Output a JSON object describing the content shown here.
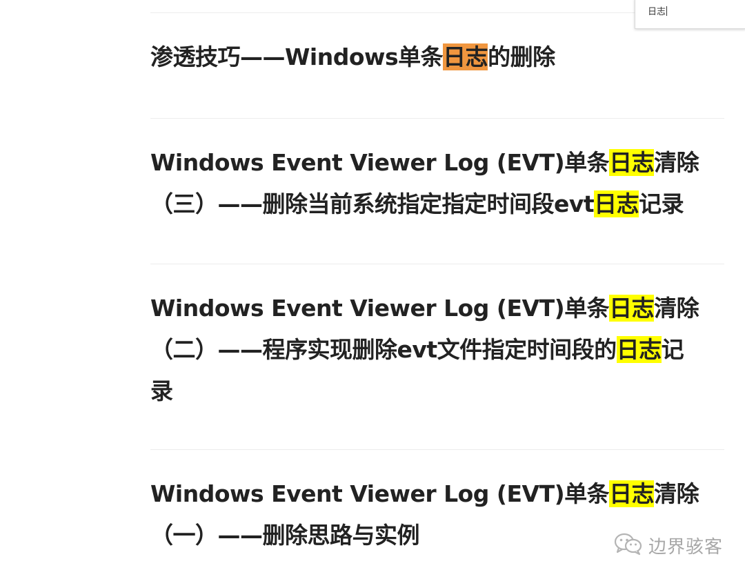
{
  "find_bar": {
    "query": "日志"
  },
  "results": [
    {
      "prefix": "渗透技巧——Windows单条",
      "highlight": "日志",
      "suffix": "的删除"
    },
    {
      "line1_prefix": "Windows Event Viewer Log (EVT)单条",
      "line1_highlight": "日志",
      "line1_suffix": "清除",
      "line2_prefix": "（三）——删除当前系统指定指定时间段evt",
      "line2_highlight": "日志",
      "line2_suffix": "记录"
    },
    {
      "line1_prefix": "Windows Event Viewer Log (EVT)单条",
      "line1_highlight": "日志",
      "line1_suffix": "清除",
      "line2_prefix": "（二）——程序实现删除evt文件指定时间段的",
      "line2_highlight": "日志",
      "line2_suffix": "记",
      "line3": "录"
    },
    {
      "line1_prefix": "Windows Event Viewer Log (EVT)单条",
      "line1_highlight": "日志",
      "line1_suffix": "清除",
      "line2": "（一）——删除思路与实例"
    }
  ],
  "watermark": {
    "text": "边界骇客",
    "icon": "wechat-icon"
  },
  "colors": {
    "current_match": "#f0963f",
    "other_match": "#ffff00",
    "title_text": "#222222",
    "divider": "#ececec"
  }
}
